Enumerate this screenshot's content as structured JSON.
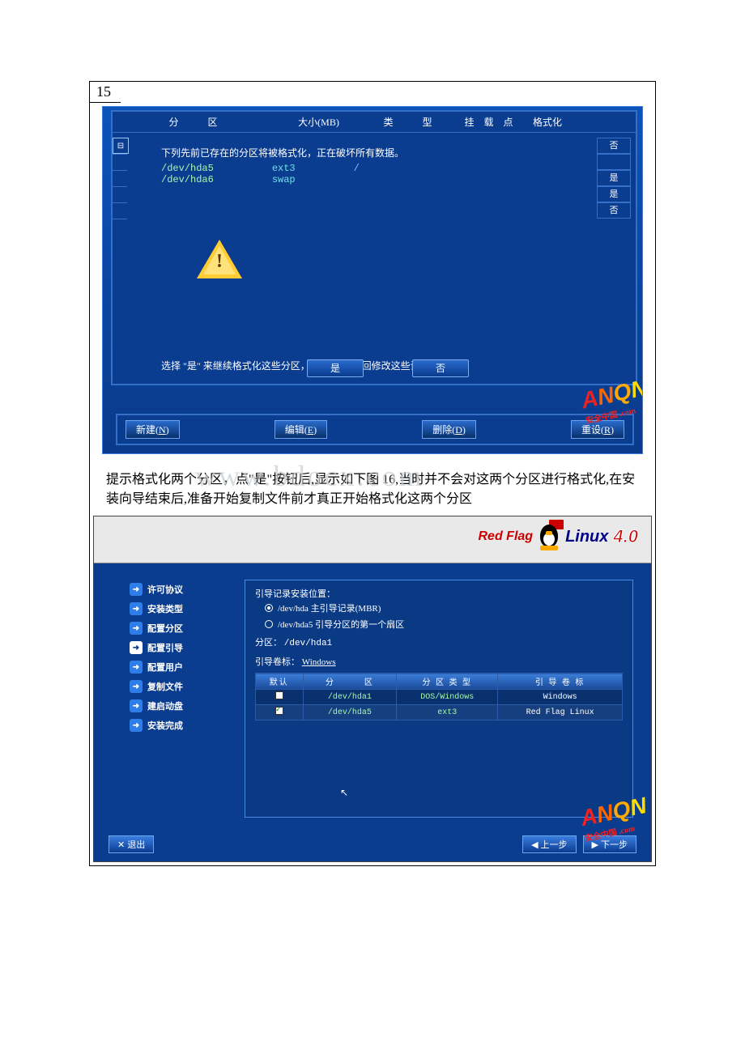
{
  "page_number": "15",
  "screenshot1": {
    "table_headers": {
      "partition": "分　　　区",
      "size": "大小(MB)",
      "type": "类　　　型",
      "mount": "挂　载　点",
      "format": "格式化"
    },
    "right_cells": [
      "否",
      "",
      "是",
      "是",
      "否"
    ],
    "dialog": {
      "title": "下列先前已存在的分区将被格式化，正在破坏所有数据。",
      "rows": [
        {
          "dev": "/dev/hda5",
          "fs": "ext3",
          "mnt": "/"
        },
        {
          "dev": "/dev/hda6",
          "fs": "swap",
          "mnt": ""
        }
      ],
      "footer": "选择 \"是\" 来继续格式化这些分区，或 \"否\" 来返回修改这些设置。",
      "yes": "是",
      "no": "否"
    },
    "buttons": {
      "new": "新建(N)",
      "edit": "编辑(E)",
      "delete": "删除(D)",
      "reset": "重设(R)"
    }
  },
  "middle_paragraph": "提示格式化两个分区，点\"是\"按钮后,显示如下图 16,当时并不会对这两个分区进行格式化,在安装向导结束后,准备开始复制文件前才真正开始格式化这两个分区",
  "watermark_center": "www.bdocx.com",
  "screenshot2": {
    "logo": {
      "redflag": "Red Flag",
      "linux": "Linux",
      "version": "4.0"
    },
    "sidebar": [
      "许可协议",
      "安装类型",
      "配置分区",
      "配置引导",
      "配置用户",
      "复制文件",
      "建启动盘",
      "安装完成"
    ],
    "sidebar_current_index": 3,
    "main": {
      "title": "引导记录安装位置：",
      "radio1": "/dev/hda 主引导记录(MBR)",
      "radio2": "/dev/hda5 引导分区的第一个扇区",
      "info_partition_label": "分区：",
      "info_partition_value": "/dev/hda1",
      "info_bootlabel_label": "引导卷标：",
      "info_bootlabel_value": "Windows",
      "table": {
        "headers": [
          "默认",
          "分　　　区",
          "分 区 类 型",
          "引 导 卷 标"
        ],
        "rows": [
          {
            "default": false,
            "partition": "/dev/hda1",
            "type": "DOS/Windows",
            "label": "Windows"
          },
          {
            "default": true,
            "partition": "/dev/hda5",
            "type": "ext3",
            "label": "Red Flag Linux"
          }
        ]
      }
    },
    "footer": {
      "exit": "退出",
      "back": "上一步",
      "next": "下一步"
    }
  },
  "anqn_watermark": {
    "text": "ANQN",
    "sub": "安全中国 .com"
  }
}
